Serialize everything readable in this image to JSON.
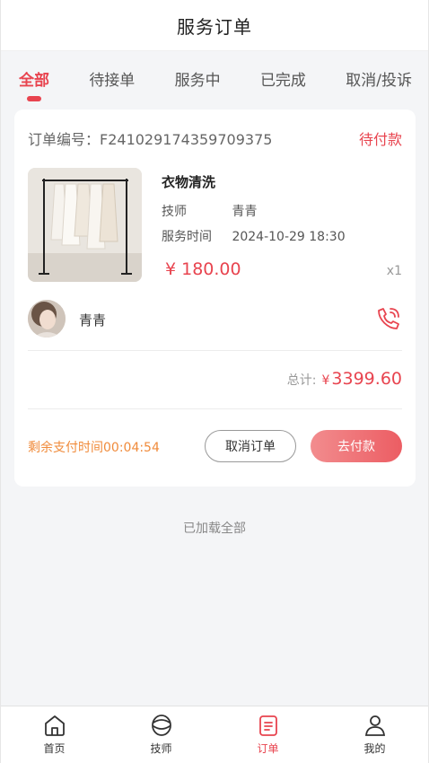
{
  "header": {
    "title": "服务订单"
  },
  "tabs": [
    {
      "label": "全部"
    },
    {
      "label": "待接单"
    },
    {
      "label": "服务中"
    },
    {
      "label": "已完成"
    },
    {
      "label": "取消/投诉"
    }
  ],
  "order": {
    "number_text": "订单编号：F241029174359709375",
    "status": "待付款",
    "service_name": "衣物清洗",
    "tech_label": "技师",
    "tech_name": "青青",
    "time_label": "服务时间",
    "time_value": "2024-10-29 18:30",
    "price": "¥ 180.00",
    "qty": "x1",
    "tech_row_name": "青青",
    "total_label": "总计:",
    "total_currency": "¥",
    "total_value": "3399.60",
    "countdown": "剩余支付时间00:04:54",
    "cancel_label": "取消订单",
    "pay_label": "去付款"
  },
  "footer_text": "已加载全部",
  "bottom_nav": [
    {
      "label": "首页",
      "icon": "home-icon"
    },
    {
      "label": "技师",
      "icon": "technician-icon"
    },
    {
      "label": "订单",
      "icon": "order-icon"
    },
    {
      "label": "我的",
      "icon": "profile-icon"
    }
  ],
  "colors": {
    "accent": "#e8444f",
    "countdown": "#f08b3b"
  }
}
